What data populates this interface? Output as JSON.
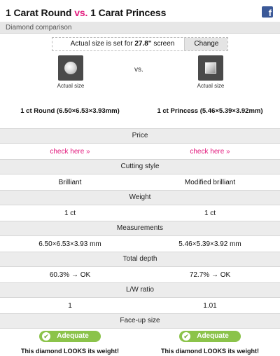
{
  "header": {
    "title_part1": "1 Carat Round",
    "title_vs": "vs.",
    "title_part2": "1 Carat Princess",
    "facebook_glyph": "f"
  },
  "subtitle": "Diamond comparison",
  "size_bar": {
    "prefix": "Actual size is set for ",
    "value": "27.8\"",
    "suffix": " screen",
    "change_label": "Change"
  },
  "comparison": {
    "vs_label": "vs.",
    "left": {
      "icon": "round-diamond-icon",
      "actual_size_label": "Actual size",
      "name": "1 ct Round (6.50×6.53×3.93mm)"
    },
    "right": {
      "icon": "princess-diamond-icon",
      "actual_size_label": "Actual size",
      "name": "1 ct Princess (5.46×5.39×3.92mm)"
    }
  },
  "sections": {
    "price": {
      "heading": "Price",
      "left": "check here »",
      "right": "check here »"
    },
    "cutting_style": {
      "heading": "Cutting style",
      "left": "Brilliant",
      "right": "Modified brilliant"
    },
    "weight": {
      "heading": "Weight",
      "left": "1 ct",
      "right": "1 ct"
    },
    "measurements": {
      "heading": "Measurements",
      "left": "6.50×6.53×3.93 mm",
      "right": "5.46×5.39×3.92 mm"
    },
    "total_depth": {
      "heading": "Total depth",
      "left": "60.3% → OK",
      "right": "72.7% → OK"
    },
    "lw_ratio": {
      "heading": "L/W ratio",
      "left": "1",
      "right": "1.01"
    },
    "face_up_size": {
      "heading": "Face-up size",
      "left_badge": "Adequate",
      "right_badge": "Adequate",
      "check_glyph": "✔",
      "left_note_pre": "This diamond ",
      "left_note_bold": "LOOKS",
      "left_note_post": " its weight!",
      "right_note_pre": "This diamond ",
      "right_note_bold": "LOOKS",
      "right_note_post": " its weight!"
    }
  },
  "colors": {
    "accent_pink": "#e2187c",
    "badge_green": "#8bc34a",
    "facebook_blue": "#3b5998",
    "section_gray": "#ececec"
  }
}
